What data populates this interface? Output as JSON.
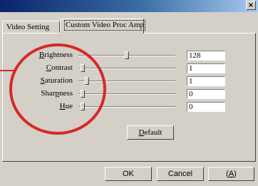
{
  "window": {
    "close_label": "×"
  },
  "tabs": [
    {
      "label": "Video Setting",
      "active": false
    },
    {
      "label": "Custom Video Proc Amp",
      "active": true
    }
  ],
  "controls": [
    {
      "label_pre": "",
      "label_u": "B",
      "label_post": "rightness",
      "value": "128"
    },
    {
      "label_pre": "",
      "label_u": "C",
      "label_post": "ontrast",
      "value": "1"
    },
    {
      "label_pre": "",
      "label_u": "S",
      "label_post": "aturation",
      "value": "1"
    },
    {
      "label_pre": "Shar",
      "label_u": "p",
      "label_post": "ness",
      "value": "0"
    },
    {
      "label_pre": "",
      "label_u": "H",
      "label_post": "ue",
      "value": "0"
    }
  ],
  "buttons": {
    "default": {
      "pre": "",
      "u": "D",
      "post": "efault"
    },
    "ok": "OK",
    "cancel": "Cancel",
    "apply": {
      "pre": "(",
      "u": "A",
      "post": ")"
    }
  },
  "colors": {
    "window_bg": "#d4d0c8",
    "titlebar_start": "#0a246a",
    "annotation_circle": "#d42a2a"
  }
}
